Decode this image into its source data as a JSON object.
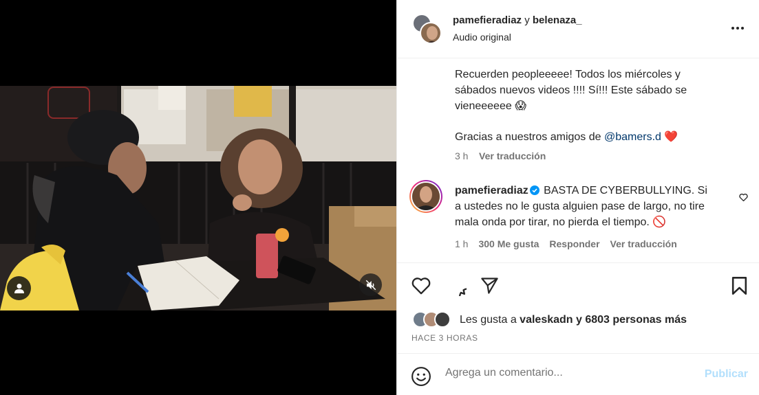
{
  "header": {
    "user_one": "pamefieradiaz",
    "separator": "y",
    "user_two": "belenaza_",
    "audio_label": "Audio original"
  },
  "caption": {
    "line1": "Recuerden peopleeeee! Todos los miércoles y sábados nuevos videos !!!! Sí!!! Este sábado se vieneeeeee 😱",
    "line2_prefix": "Gracias a nuestros amigos de ",
    "line2_mention": "@bamers.d",
    "line2_suffix": " ❤️",
    "time": "3 h",
    "translate": "Ver traducción"
  },
  "comment": {
    "username": "pamefieradiaz",
    "text": "BASTA DE CYBERBULLYING. Si a ustedes no le gusta alguien pase de largo, no tire mala onda por tirar, no pierda el tiempo. 🚫",
    "time": "1 h",
    "likes": "300 Me gusta",
    "reply": "Responder",
    "translate": "Ver traducción"
  },
  "likes": {
    "prefix": "Les gusta a ",
    "user": "valeskadn",
    "middle": " y ",
    "count": "6803 personas más"
  },
  "time_ago": "HACE 3 HORAS",
  "comment_box": {
    "placeholder": "Agrega un comentario...",
    "post_label": "Publicar"
  },
  "icons": {
    "more": "more-options-icon",
    "verified": "verified-badge-icon",
    "comment_like": "heart-outline-icon",
    "like": "heart-icon",
    "comment": "comment-icon",
    "share": "send-icon",
    "save": "bookmark-icon",
    "emoji": "emoji-icon",
    "tag": "user-tag-icon",
    "mute": "muted-speaker-icon"
  },
  "colors": {
    "link": "#00376b",
    "verified": "#0095f6",
    "post_disabled": "#b2dffc",
    "secondary_text": "#737373"
  }
}
